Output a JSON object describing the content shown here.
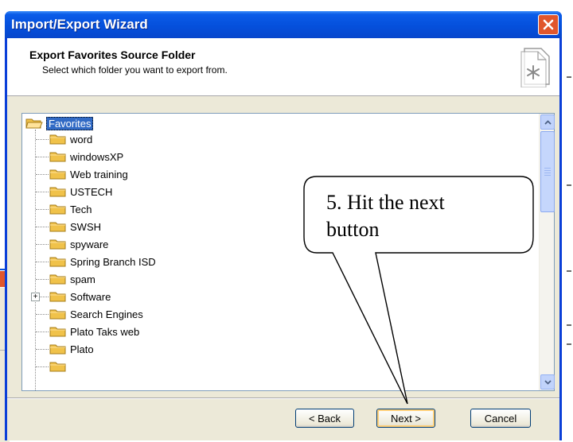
{
  "window": {
    "title": "Import/Export Wizard"
  },
  "header": {
    "title": "Export Favorites Source Folder",
    "subtitle": "Select which folder you want to export from.",
    "icon": "favorites-page-star-icon"
  },
  "tree": {
    "root": {
      "label": "Favorites",
      "icon": "folder-open-icon",
      "selected": true
    },
    "items": [
      {
        "label": "word",
        "expandable": false
      },
      {
        "label": "windowsXP",
        "expandable": false
      },
      {
        "label": "Web training",
        "expandable": false
      },
      {
        "label": "USTECH",
        "expandable": false
      },
      {
        "label": "Tech",
        "expandable": false
      },
      {
        "label": "SWSH",
        "expandable": false
      },
      {
        "label": "spyware",
        "expandable": false
      },
      {
        "label": "Spring Branch ISD",
        "expandable": false
      },
      {
        "label": "spam",
        "expandable": false
      },
      {
        "label": "Software",
        "expandable": true
      },
      {
        "label": "Search Engines",
        "expandable": false
      },
      {
        "label": "Plato Taks web",
        "expandable": false
      },
      {
        "label": "Plato",
        "expandable": false
      }
    ],
    "expander_symbol": "+"
  },
  "buttons": {
    "back": "< Back",
    "next": "Next >",
    "cancel": "Cancel"
  },
  "callout": {
    "line1": "5. Hit the next",
    "line2": "button"
  },
  "colors": {
    "titlebar": "#0550dc",
    "close": "#e0562c",
    "selection": "#316ac5",
    "folder": "#f0c24a"
  }
}
